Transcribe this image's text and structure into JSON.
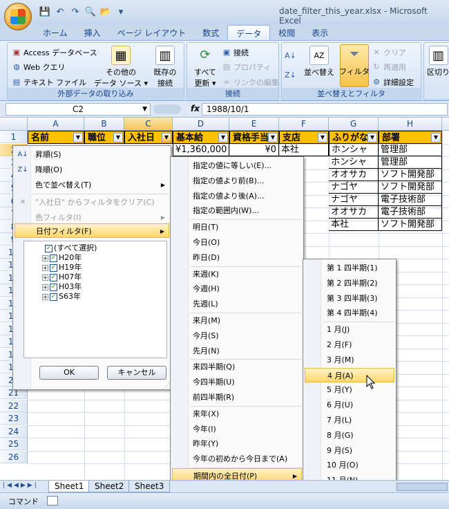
{
  "window": {
    "title": "date_filter_this_year.xlsx - Microsoft Excel"
  },
  "qat": {
    "save": "💾",
    "undo": "↶",
    "redo": "↷",
    "dropdown": "▾"
  },
  "tabs": [
    "ホーム",
    "挿入",
    "ページ レイアウト",
    "数式",
    "データ",
    "校閲",
    "表示"
  ],
  "ribbon": {
    "external": {
      "label": "外部データの取り込み",
      "access": "Access データベース",
      "web": "Web クエリ",
      "text": "テキスト ファイル",
      "other_line1": "その他の",
      "other_line2": "データ ソース ▾",
      "existing_line1": "既存の",
      "existing_line2": "接続"
    },
    "connections": {
      "label": "接続",
      "refresh_line1": "すべて",
      "refresh_line2": "更新 ▾",
      "connect": "接続",
      "properties": "プロパティ",
      "edit_links": "リンクの編集"
    },
    "sort": {
      "label": "並べ替えとフィルタ",
      "sort": "並べ替え",
      "filter": "フィルタ",
      "clear": "クリア",
      "reapply": "再適用",
      "advanced": "詳細設定"
    },
    "partial": "区切り"
  },
  "formula": {
    "namebox": "C2",
    "fx": "fx",
    "value": "1988/10/1"
  },
  "columns": [
    "A",
    "B",
    "C",
    "D",
    "E",
    "F",
    "G",
    "H"
  ],
  "rows": [
    "1",
    "2",
    "3",
    "4",
    "5",
    "6",
    "7",
    "8",
    "9",
    "10",
    "11",
    "12",
    "13",
    "14",
    "15",
    "16",
    "17",
    "18",
    "19",
    "20",
    "21",
    "22",
    "23",
    "24",
    "25",
    "26"
  ],
  "headers": [
    "名前",
    "職位",
    "入社日",
    "基本給",
    "資格手当",
    "支店",
    "ふりがな",
    "部署"
  ],
  "cells": {
    "d2": "¥1,360,000",
    "e2": "¥0",
    "f2": "本社",
    "f5": "屋",
    "f6": "屋",
    "g": [
      "ホンシャ",
      "ホンシャ",
      "オオサカ",
      "ナゴヤ",
      "ナゴヤ",
      "オオサカ",
      "本社"
    ],
    "h": [
      "管理部",
      "管理部",
      "ソフト開発部",
      "ソフト開発部",
      "電子技術部",
      "電子技術部",
      "ソフト開発部"
    ]
  },
  "filter_menu": {
    "sort_asc": "昇順(S)",
    "sort_desc": "降順(O)",
    "sort_color": "色で並べ替え(T)",
    "clear_filter": "\"入社日\" からフィルタをクリア(C)",
    "color_filter": "色フィルタ(I)",
    "date_filter": "日付フィルタ(F)",
    "tree": [
      "(すべて選択)",
      "H20年",
      "H19年",
      "H07年",
      "H03年",
      "S63年"
    ],
    "ok": "OK",
    "cancel": "キャンセル"
  },
  "date_menu": [
    "指定の値に等しい(E)...",
    "指定の値より前(B)...",
    "指定の値より後(A)...",
    "指定の範囲内(W)...",
    "明日(T)",
    "今日(O)",
    "昨日(D)",
    "来週(K)",
    "今週(H)",
    "先週(L)",
    "来月(M)",
    "今月(S)",
    "先月(N)",
    "来四半期(Q)",
    "今四半期(U)",
    "前四半期(R)",
    "来年(X)",
    "今年(I)",
    "昨年(Y)",
    "今年の初めから今日まで(A)",
    "期間内の全日付(P)",
    "ユーザー設定フィルタ(F)..."
  ],
  "period_menu": [
    "第 1 四半期(1)",
    "第 2 四半期(2)",
    "第 3 四半期(3)",
    "第 4 四半期(4)",
    "1 月(J)",
    "2 月(F)",
    "3 月(M)",
    "4 月(A)",
    "5 月(Y)",
    "6 月(U)",
    "7 月(L)",
    "8 月(G)",
    "9 月(S)",
    "10 月(O)",
    "11 月(N)",
    "12 月(D)"
  ],
  "sheets": [
    "Sheet1",
    "Sheet2",
    "Sheet3"
  ],
  "status": {
    "mode": "コマンド"
  }
}
